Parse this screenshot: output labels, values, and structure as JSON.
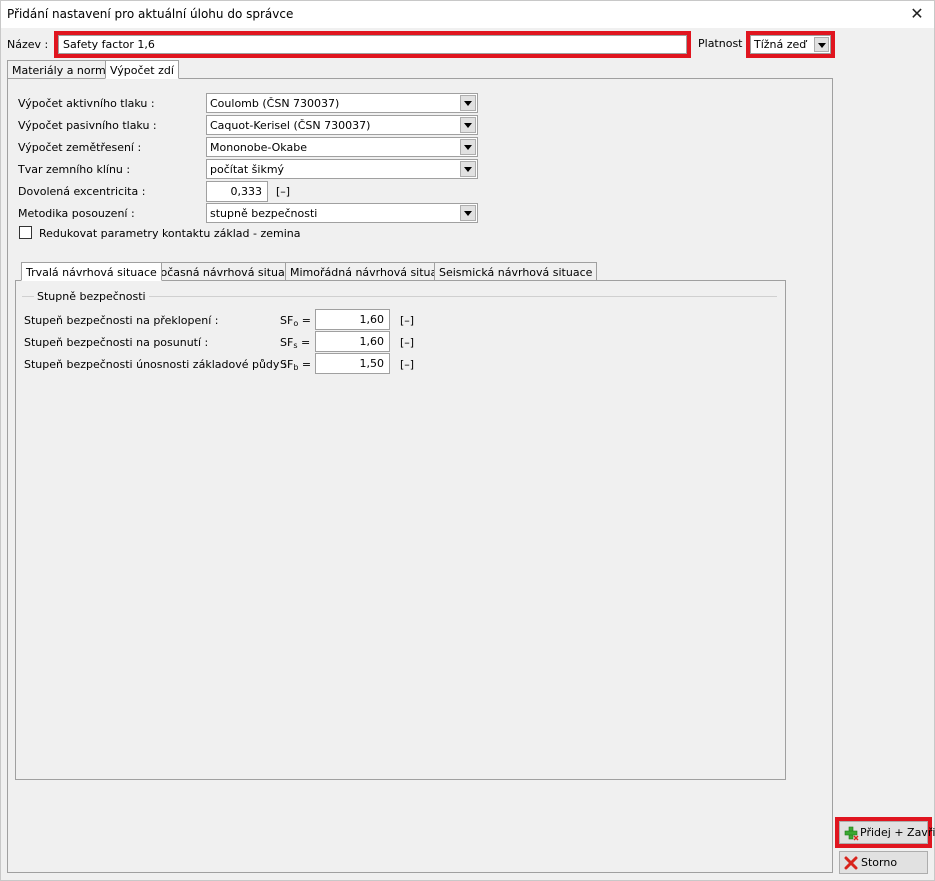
{
  "window": {
    "title": "Přidání nastavení pro aktuální úlohu do správce",
    "close_symbol": "✕"
  },
  "header": {
    "name_label": "Název :",
    "name_value": "Safety factor 1,6",
    "validity_label": "Platnost :",
    "validity_value": "Tížná zeď"
  },
  "main_tabs": [
    {
      "label": "Materiály a normy"
    },
    {
      "label": "Výpočet zdí"
    }
  ],
  "settings": {
    "active_pressure": {
      "label": "Výpočet aktivního tlaku :",
      "value": "Coulomb (ČSN 730037)"
    },
    "passive_pressure": {
      "label": "Výpočet pasivního tlaku :",
      "value": "Caquot-Kerisel (ČSN 730037)"
    },
    "earthquake": {
      "label": "Výpočet zemětřesení :",
      "value": "Mononobe-Okabe"
    },
    "wedge_shape": {
      "label": "Tvar zemního klínu :",
      "value": "počítat šikmý"
    },
    "eccentricity": {
      "label": "Dovolená excentricita :",
      "value": "0,333",
      "unit": "[–]"
    },
    "methodology": {
      "label": "Metodika posouzení :",
      "value": "stupně bezpečnosti"
    },
    "reduce_params": {
      "label": "Redukovat parametry kontaktu základ - zemina",
      "checked": false
    }
  },
  "situation_tabs": [
    {
      "label": "Trvalá návrhová situace"
    },
    {
      "label": "Dočasná návrhová situace"
    },
    {
      "label": "Mimořádná návrhová situace"
    },
    {
      "label": "Seismická návrhová situace"
    }
  ],
  "safety": {
    "group_title": "Stupně bezpečnosti",
    "rows": [
      {
        "label": "Stupeň bezpečnosti na překlopení :",
        "symbol": "SF",
        "sub": "o",
        "eq": "=",
        "value": "1,60",
        "unit": "[–]"
      },
      {
        "label": "Stupeň bezpečnosti na posunutí :",
        "symbol": "SF",
        "sub": "s",
        "eq": "=",
        "value": "1,60",
        "unit": "[–]"
      },
      {
        "label": "Stupeň bezpečnosti únosnosti základové půdy :",
        "symbol": "SF",
        "sub": "b",
        "eq": "=",
        "value": "1,50",
        "unit": "[–]"
      }
    ]
  },
  "buttons": {
    "add_close": "Přidej + Zavři",
    "cancel": "Storno"
  },
  "colors": {
    "highlight": "#e0151f",
    "add_icon": "#3aa832",
    "cancel_icon": "#d8241c"
  }
}
